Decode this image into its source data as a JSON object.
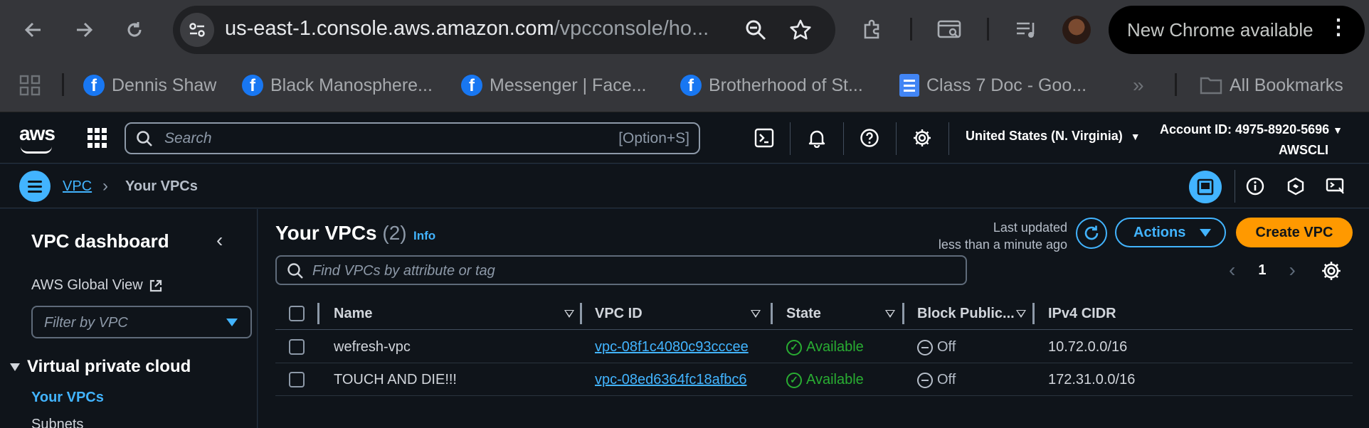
{
  "browser": {
    "url_host": "us-east-1.console.aws.amazon.com",
    "url_path": "/vpcconsole/ho...",
    "new_chrome_label": "New Chrome available",
    "bookmarks": [
      {
        "label": "Dennis Shaw",
        "icon": "facebook-icon"
      },
      {
        "label": "Black Manosphere...",
        "icon": "facebook-icon"
      },
      {
        "label": "Messenger | Face...",
        "icon": "facebook-icon"
      },
      {
        "label": "Brotherhood of St...",
        "icon": "facebook-icon"
      },
      {
        "label": "Class 7 Doc - Goo...",
        "icon": "google-docs-icon"
      }
    ],
    "overflow_label": "»",
    "all_bookmarks_label": "All Bookmarks"
  },
  "aws_header": {
    "logo_text": "aws",
    "search_placeholder": "Search",
    "search_shortcut": "[Option+S]",
    "region": "United States (N. Virginia)",
    "account_id": "Account ID: 4975-8920-5696",
    "account_alias": "AWSCLI"
  },
  "breadcrumb": {
    "parent": "VPC",
    "separator": "›",
    "current": "Your VPCs"
  },
  "sidebar": {
    "title": "VPC dashboard",
    "collapse_glyph": "‹",
    "global_view": "AWS Global View",
    "filter_placeholder": "Filter by VPC",
    "section": "Virtual private cloud",
    "active_item": "Your VPCs",
    "next_item": "Subnets"
  },
  "main": {
    "title": "Your VPCs",
    "count": "(2)",
    "info": "Info",
    "last_updated_line1": "Last updated",
    "last_updated_line2": "less than a minute ago",
    "actions_label": "Actions",
    "create_label": "Create VPC",
    "find_placeholder": "Find VPCs by attribute or tag",
    "page_prev": "‹",
    "page": "1",
    "page_next": "›",
    "columns": [
      "Name",
      "VPC ID",
      "State",
      "Block Public...",
      "IPv4 CIDR"
    ],
    "rows": [
      {
        "name": "wefresh-vpc",
        "vpc_id": "vpc-08f1c4080c93cccee",
        "state": "Available",
        "block_public": "Off",
        "cidr": "10.72.0.0/16"
      },
      {
        "name": "TOUCH AND DIE!!!",
        "vpc_id": "vpc-08ed6364fc18afbc6",
        "state": "Available",
        "block_public": "Off",
        "cidr": "172.31.0.0/16"
      }
    ]
  },
  "colors": {
    "accent_blue": "#42b4ff",
    "create_orange": "#ff9900",
    "available_green": "#29ad32",
    "background": "#0f141a"
  }
}
